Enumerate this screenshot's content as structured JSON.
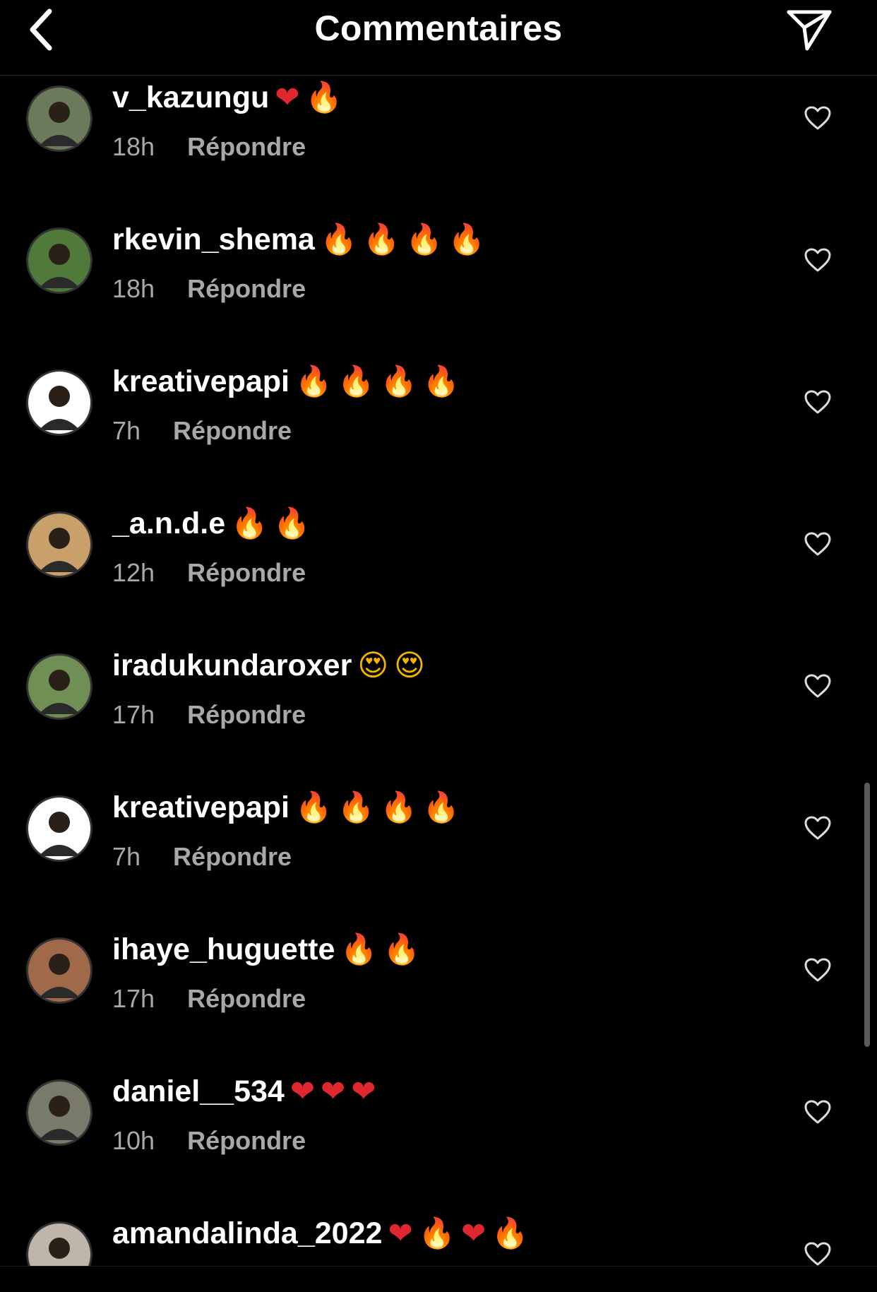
{
  "header": {
    "title": "Commentaires",
    "back_icon": "chevron-left-icon",
    "send_icon": "paper-plane-icon"
  },
  "comments": [
    {
      "username": "v_kazungu",
      "emoji": [
        "heart",
        "fire"
      ],
      "time": "18h",
      "reply": "Répondre",
      "avatar_color": "#6b7a5a"
    },
    {
      "username": "rkevin_shema",
      "emoji": [
        "fire",
        "fire",
        "fire",
        "fire"
      ],
      "time": "18h",
      "reply": "Répondre",
      "avatar_color": "#4f7a3a"
    },
    {
      "username": "kreativepapi",
      "emoji": [
        "fire",
        "fire",
        "fire",
        "fire"
      ],
      "time": "7h",
      "reply": "Répondre",
      "avatar_color": "#ffffff"
    },
    {
      "username": "_a.n.d.e",
      "emoji": [
        "fire",
        "fire"
      ],
      "time": "12h",
      "reply": "Répondre",
      "avatar_color": "#c9a06a"
    },
    {
      "username": "iradukundaroxer",
      "emoji": [
        "love",
        "love"
      ],
      "time": "17h",
      "reply": "Répondre",
      "avatar_color": "#6f8f55"
    },
    {
      "username": "kreativepapi",
      "emoji": [
        "fire",
        "fire",
        "fire",
        "fire"
      ],
      "time": "7h",
      "reply": "Répondre",
      "avatar_color": "#ffffff"
    },
    {
      "username": "ihaye_huguette",
      "emoji": [
        "fire",
        "fire"
      ],
      "time": "17h",
      "reply": "Répondre",
      "avatar_color": "#a06a4a"
    },
    {
      "username": "daniel__534",
      "emoji": [
        "heart",
        "heart",
        "heart"
      ],
      "time": "10h",
      "reply": "Répondre",
      "avatar_color": "#7a7a6a"
    },
    {
      "username": "amandalinda_2022",
      "emoji": [
        "heart",
        "fire",
        "heart",
        "fire"
      ],
      "time": "",
      "reply": "",
      "avatar_color": "#bfb5ab"
    }
  ],
  "icons": {
    "heart": "❤",
    "fire": "🔥",
    "love": "😍",
    "like_icon": "heart-outline-icon"
  }
}
